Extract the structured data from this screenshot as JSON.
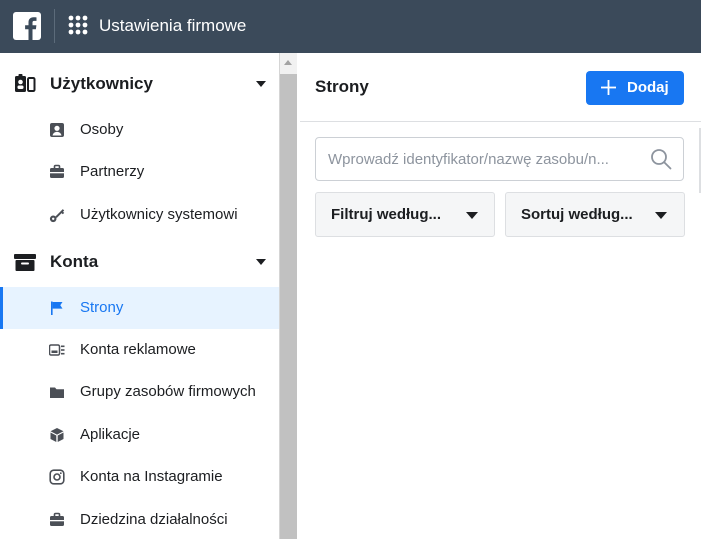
{
  "topbar": {
    "title": "Ustawienia firmowe",
    "logo_icon": "facebook-logo-icon",
    "apps_icon": "grid-dots-icon",
    "background": "#3b4a5a"
  },
  "sidebar": {
    "sections": [
      {
        "label": "Użytkownicy",
        "icon": "users-badge-icon",
        "items": [
          {
            "label": "Osoby",
            "icon": "person-card-icon"
          },
          {
            "label": "Partnerzy",
            "icon": "briefcase-icon"
          },
          {
            "label": "Użytkownicy systemowi",
            "icon": "key-icon"
          }
        ]
      },
      {
        "label": "Konta",
        "icon": "archive-box-icon",
        "items": [
          {
            "label": "Strony",
            "icon": "flag-icon",
            "active": true
          },
          {
            "label": "Konta reklamowe",
            "icon": "ad-account-icon"
          },
          {
            "label": "Grupy zasobów firmowych",
            "icon": "folder-icon"
          },
          {
            "label": "Aplikacje",
            "icon": "cube-icon"
          },
          {
            "label": "Konta na Instagramie",
            "icon": "instagram-icon"
          },
          {
            "label": "Dziedzina działalności",
            "icon": "briefcase-icon"
          }
        ]
      }
    ]
  },
  "main": {
    "title": "Strony",
    "add_button_label": "Dodaj",
    "search_placeholder": "Wprowadź identyfikator/nazwę zasobu/n...",
    "filter_label": "Filtruj według...",
    "sort_label": "Sortuj według..."
  },
  "colors": {
    "accent": "#1877f2",
    "active_bg": "#e7f3ff"
  }
}
